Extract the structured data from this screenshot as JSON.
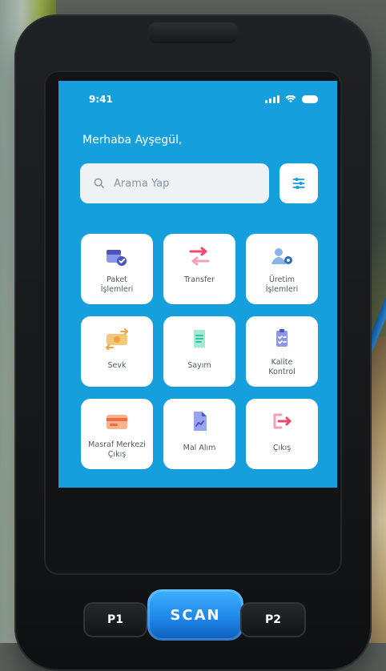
{
  "status_bar": {
    "time": "9:41"
  },
  "greeting": "Merhaba Ayşegül,",
  "search": {
    "placeholder": "Arama Yap"
  },
  "menu": {
    "items": [
      {
        "label": "Paket\nİşlemleri",
        "icon": "package-check-icon",
        "colors": [
          "#4c56b8",
          "#8c96ea"
        ]
      },
      {
        "label": "Transfer",
        "icon": "transfer-arrows-icon",
        "colors": [
          "#ef4a71",
          "#f2a1b4"
        ]
      },
      {
        "label": "Üretim\nİşlemleri",
        "icon": "user-gear-icon",
        "colors": [
          "#2b6db6",
          "#89b4e6"
        ]
      },
      {
        "label": "Sevk",
        "icon": "money-transfer-icon",
        "colors": [
          "#f0a13d",
          "#f6c77a"
        ]
      },
      {
        "label": "Sayım",
        "icon": "receipt-icon",
        "colors": [
          "#35c2a1",
          "#a7e7d6"
        ]
      },
      {
        "label": "Kalite\nKontrol",
        "icon": "checklist-icon",
        "colors": [
          "#4c56b8",
          "#8c96ea"
        ]
      },
      {
        "label": "Masraf Merkezi\nÇıkış",
        "icon": "credit-card-icon",
        "colors": [
          "#f26a3d",
          "#f6b38e"
        ]
      },
      {
        "label": "Mal Alım",
        "icon": "document-chart-icon",
        "colors": [
          "#4c56b8",
          "#9aa3f0"
        ]
      },
      {
        "label": "Çıkış",
        "icon": "logout-icon",
        "colors": [
          "#e84a6e",
          "#f3a2b5"
        ]
      }
    ]
  },
  "device_buttons": {
    "p1": "P1",
    "scan": "SCAN",
    "p2": "P2"
  },
  "colors": {
    "screen_background": "#159fdd",
    "tile_background": "#ffffff",
    "search_background": "#eef2f4"
  }
}
